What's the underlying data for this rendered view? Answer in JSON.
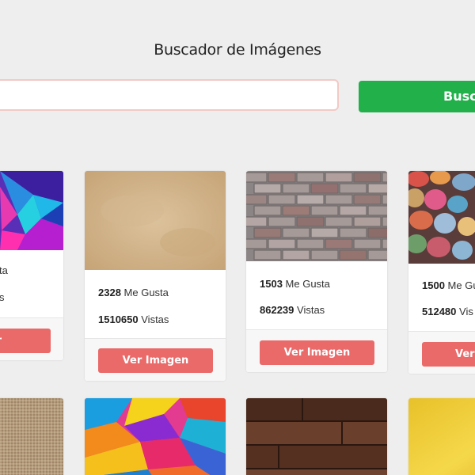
{
  "header": {
    "title": "Buscador de Imágenes"
  },
  "search": {
    "placeholder": "",
    "value": "",
    "button_label": "Buscar"
  },
  "cards": [
    {
      "likes": "",
      "likes_label": "ta",
      "views": "",
      "views_label": "s",
      "button_label": "Ver Imagen",
      "image": "polygon-colorful"
    },
    {
      "likes": "2328",
      "likes_label": "Me Gusta",
      "views": "1510650",
      "views_label": "Vistas",
      "button_label": "Ver Imagen",
      "image": "parchment-texture"
    },
    {
      "likes": "1503",
      "likes_label": "Me Gusta",
      "views": "862239",
      "views_label": "Vistas",
      "button_label": "Ver Imagen",
      "image": "brick-wall"
    },
    {
      "likes": "1500",
      "likes_label": "Me Gu",
      "views": "512480",
      "views_label": "Vis",
      "button_label": "Ver I",
      "image": "colorful-stones"
    }
  ],
  "bottom_row_images": [
    "burlap-texture",
    "paint-splash",
    "wood-planks",
    "gold-foil"
  ],
  "colors": {
    "accent_green": "#22b04b",
    "button_red": "#ea6a6a",
    "input_border": "#f1c9c6"
  }
}
